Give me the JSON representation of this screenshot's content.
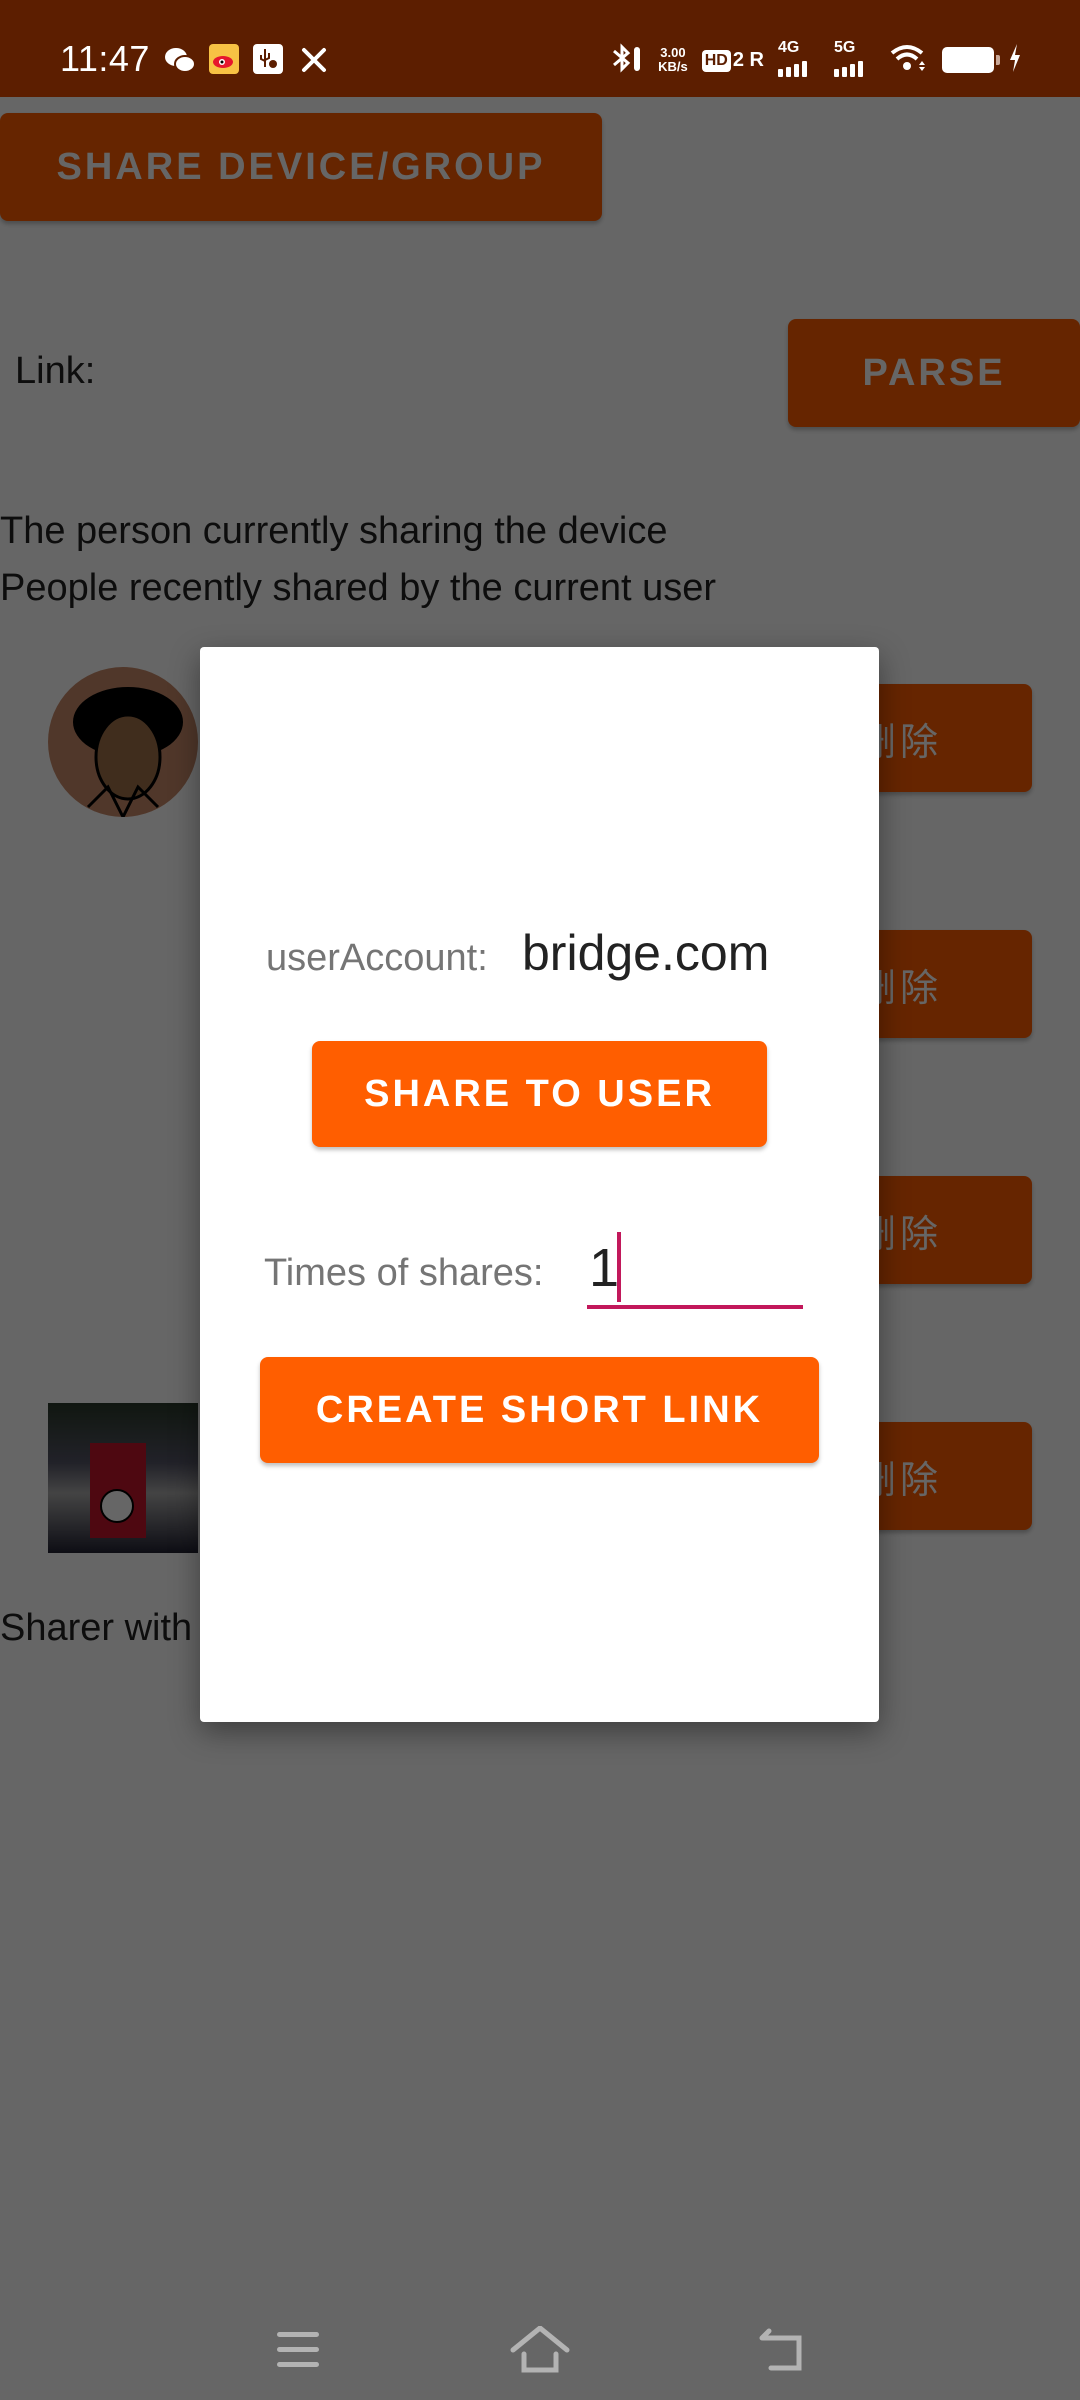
{
  "status_bar": {
    "time": "11:47",
    "notification_icons": [
      "wechat-icon",
      "weibo-icon",
      "usb-debug-icon",
      "tools-icon"
    ],
    "network_speed_value": "3.00",
    "network_speed_unit": "KB/s",
    "hd_label": "HD",
    "sim_slot": "2",
    "roaming": "R",
    "sim1_network": "4G",
    "sim2_network": "5G",
    "system_icons": [
      "bluetooth-icon",
      "hd-voice-icon",
      "signal-4g-icon",
      "signal-5g-icon",
      "wifi-icon",
      "battery-icon",
      "charging-icon"
    ]
  },
  "background": {
    "share_device_button": "SHARE DEVICE/GROUP",
    "link_label": "Link:",
    "parse_button": "PARSE",
    "current_sharing_text": "The person currently sharing the device",
    "recent_shared_text": "People recently shared by the current user",
    "delete_buttons": [
      "删除",
      "删除",
      "删除",
      "删除"
    ],
    "sharer_text": "Sharer with"
  },
  "dialog": {
    "user_account_label": "userAccount:",
    "user_account_value": "bridge.com",
    "share_to_user_button": "SHARE TO USER",
    "times_label": "Times of shares:",
    "times_value": "1",
    "create_short_link_button": "CREATE SHORT LINK"
  },
  "nav_bar": {
    "buttons": [
      "menu-icon",
      "home-icon",
      "back-icon"
    ]
  },
  "colors": {
    "accent_orange": "#ff5e00",
    "status_bar": "#5c1e00",
    "input_underline": "#c2185b"
  }
}
